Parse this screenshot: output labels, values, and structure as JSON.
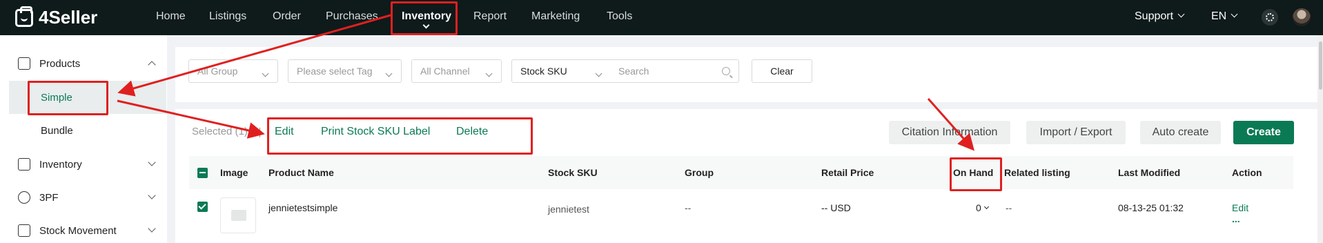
{
  "app": {
    "logo_text": "4Seller"
  },
  "topnav": {
    "items": [
      {
        "label": "Home"
      },
      {
        "label": "Listings"
      },
      {
        "label": "Order"
      },
      {
        "label": "Purchases"
      },
      {
        "label": "Inventory"
      },
      {
        "label": "Report"
      },
      {
        "label": "Marketing"
      },
      {
        "label": "Tools"
      }
    ],
    "support": "Support",
    "language": "EN"
  },
  "sidebar": {
    "products": "Products",
    "simple": "Simple",
    "bundle": "Bundle",
    "inventory": "Inventory",
    "tpf": "3PF",
    "stock_movement": "Stock Movement"
  },
  "filters": {
    "group": "All Group",
    "tag": "Please select Tag",
    "channel": "All Channel",
    "search_field": "Stock SKU",
    "search_placeholder": "Search",
    "clear": "Clear"
  },
  "toolbar": {
    "selected": "Selected (1)",
    "edit": "Edit",
    "print_label": "Print Stock SKU Label",
    "delete": "Delete",
    "citation": "Citation Information",
    "import_export": "Import / Export",
    "auto_create": "Auto create",
    "create": "Create"
  },
  "table": {
    "columns": {
      "image": "Image",
      "product_name": "Product Name",
      "stock_sku": "Stock SKU",
      "group": "Group",
      "retail_price": "Retail Price",
      "on_hand": "On Hand",
      "related_listing": "Related listing",
      "last_modified": "Last Modified",
      "action": "Action"
    },
    "rows": [
      {
        "product_name": "jennietestsimple",
        "stock_sku": "jennietest",
        "group": "--",
        "retail_price": "-- USD",
        "on_hand": "0",
        "related_listing": "--",
        "last_modified": "08-13-25 01:32",
        "action_edit": "Edit",
        "action_more": "..."
      }
    ]
  },
  "colors": {
    "topbar": "#0f1a1a",
    "accent": "#0a7a55",
    "annotation": "#e02020"
  }
}
